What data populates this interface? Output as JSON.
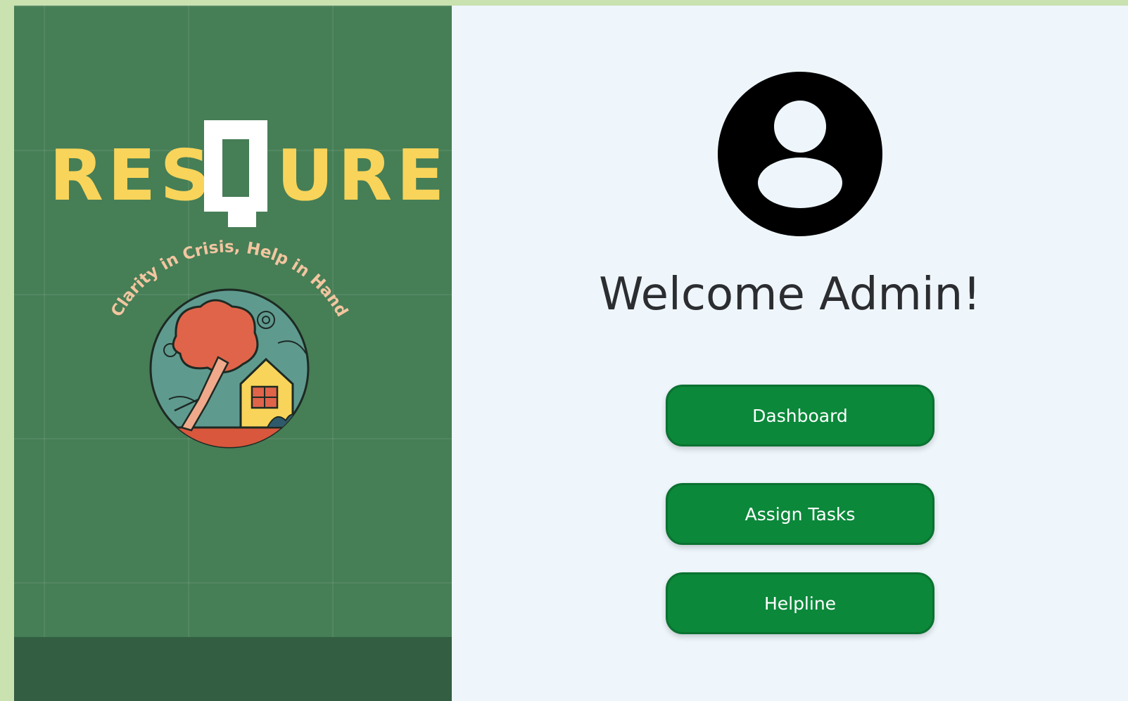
{
  "brand": {
    "logo_text": "RESQURE",
    "tagline": "Clarity in Crisis, Help in Hand",
    "colors": {
      "panel": "#467e56",
      "logo_yellow": "#f8d45a",
      "logo_white": "#ffffff",
      "tagline": "#f3c6a0"
    }
  },
  "main": {
    "avatar_icon": "user-circle-icon",
    "welcome": "Welcome Admin!",
    "buttons": {
      "dashboard": "Dashboard",
      "assign_tasks": "Assign Tasks",
      "helpline": "Helpline"
    },
    "colors": {
      "button": "#0b883a",
      "background": "#eef6fc"
    }
  }
}
